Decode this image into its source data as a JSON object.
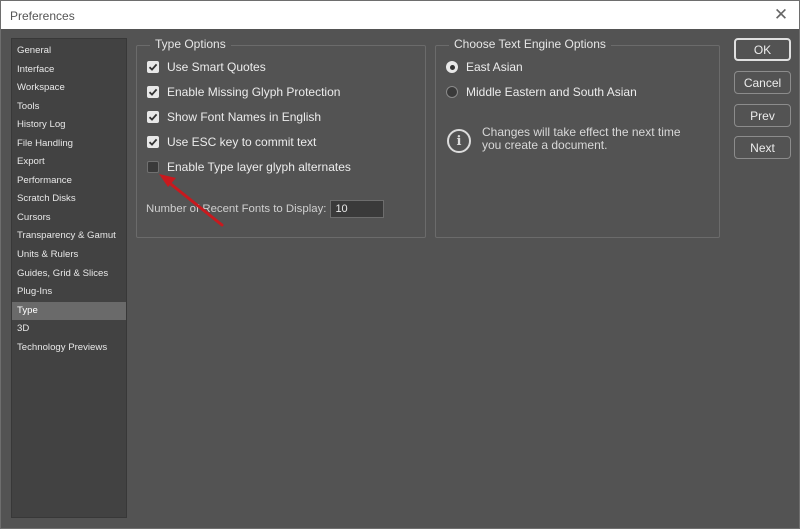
{
  "window": {
    "title": "Preferences",
    "close_glyph": "✕"
  },
  "sidebar": {
    "items": [
      {
        "label": "General"
      },
      {
        "label": "Interface"
      },
      {
        "label": "Workspace"
      },
      {
        "label": "Tools"
      },
      {
        "label": "History Log"
      },
      {
        "label": "File Handling"
      },
      {
        "label": "Export"
      },
      {
        "label": "Performance"
      },
      {
        "label": "Scratch Disks"
      },
      {
        "label": "Cursors"
      },
      {
        "label": "Transparency & Gamut"
      },
      {
        "label": "Units & Rulers"
      },
      {
        "label": "Guides, Grid & Slices"
      },
      {
        "label": "Plug-Ins"
      },
      {
        "label": "Type"
      },
      {
        "label": "3D"
      },
      {
        "label": "Technology Previews"
      }
    ],
    "selected": "Type"
  },
  "type_options": {
    "title": "Type Options",
    "options": [
      {
        "label": "Use Smart Quotes",
        "checked": true
      },
      {
        "label": "Enable Missing Glyph Protection",
        "checked": true
      },
      {
        "label": "Show Font Names in English",
        "checked": true
      },
      {
        "label": "Use ESC key to commit text",
        "checked": true
      },
      {
        "label": "Enable Type layer glyph alternates",
        "checked": false
      }
    ],
    "recent_fonts_label": "Number of Recent Fonts to Display:",
    "recent_fonts_value": "10"
  },
  "text_engine": {
    "title": "Choose Text Engine Options",
    "options": [
      {
        "label": "East Asian",
        "selected": true
      },
      {
        "label": "Middle Eastern and South Asian",
        "selected": false
      }
    ],
    "info_glyph": "i",
    "info_line1": "Changes will take effect the next time",
    "info_line2": "you create a document."
  },
  "buttons": {
    "ok": "OK",
    "cancel": "Cancel",
    "prev": "Prev",
    "next": "Next"
  },
  "colors": {
    "dialog_bg": "#535353",
    "sidebar_bg": "#424242",
    "selected_bg": "#6a6a6a",
    "annotation_arrow": "#c8191e"
  }
}
